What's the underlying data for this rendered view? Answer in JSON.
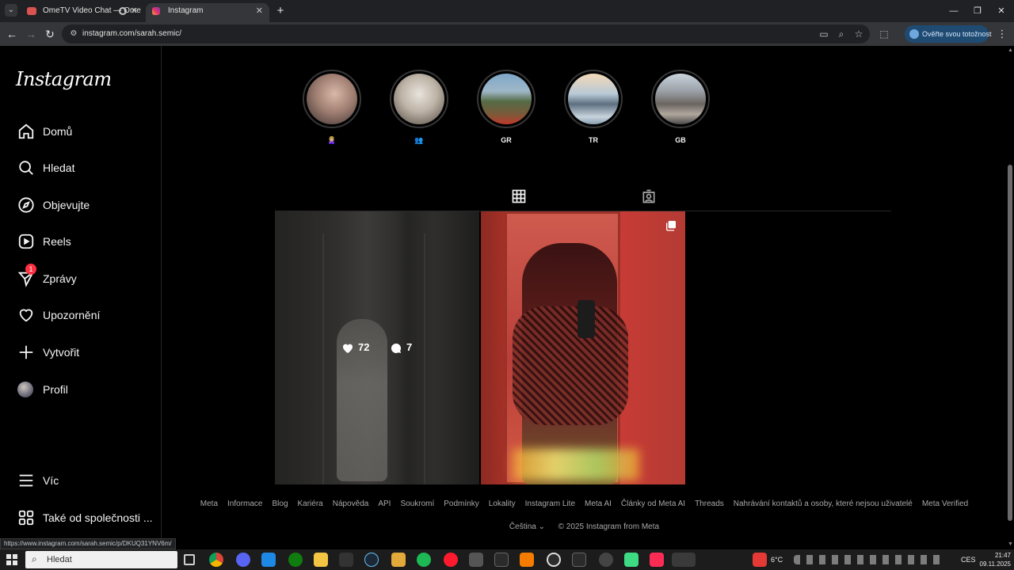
{
  "browser": {
    "tabs": [
      {
        "title": "OmeTV Video Chat — Ome",
        "active": false
      },
      {
        "title": "Instagram",
        "active": true
      }
    ],
    "url": "instagram.com/sarah.semic/",
    "verify_label": "Ověřte svou totožnost",
    "status_url": "https://www.instagram.com/sarah.semic/p/DKUQ31YNV6m/"
  },
  "instagram": {
    "logo": "Instagram",
    "nav": [
      {
        "label": "Domů",
        "icon": "home-icon"
      },
      {
        "label": "Hledat",
        "icon": "search-icon"
      },
      {
        "label": "Objevujte",
        "icon": "explore-compass-icon"
      },
      {
        "label": "Reels",
        "icon": "reels-icon"
      },
      {
        "label": "Zprávy",
        "icon": "messenger-icon",
        "badge": "1"
      },
      {
        "label": "Upozornění",
        "icon": "heart-icon"
      },
      {
        "label": "Vytvořit",
        "icon": "plus-icon"
      },
      {
        "label": "Profil",
        "icon": "avatar"
      },
      {
        "label": "Víc",
        "icon": "menu-icon"
      },
      {
        "label": "Také od společnosti ...",
        "icon": "meta-apps-icon"
      }
    ],
    "highlights": [
      {
        "label": "🙎🏼‍♀️"
      },
      {
        "label": "👥"
      },
      {
        "label": "GR"
      },
      {
        "label": "TR"
      },
      {
        "label": "GB"
      }
    ],
    "profile_tabs": [
      {
        "name": "posts-grid",
        "icon": "grid-icon",
        "active": true
      },
      {
        "name": "tagged",
        "icon": "tagged-icon",
        "active": false
      }
    ],
    "posts": [
      {
        "likes": "72",
        "comments": "7",
        "hovered": true
      },
      {
        "multi": true,
        "hovered": false
      }
    ],
    "footer_links": [
      "Meta",
      "Informace",
      "Blog",
      "Kariéra",
      "Nápověda",
      "API",
      "Soukromí",
      "Podmínky",
      "Lokality",
      "Instagram Lite",
      "Meta AI",
      "Články od Meta AI",
      "Threads",
      "Nahrávání kontaktů a osoby, které nejsou uživatelé",
      "Meta Verified"
    ],
    "language": "Čeština",
    "copyright": "© 2025 Instagram from Meta"
  },
  "taskbar": {
    "search_placeholder": "Hledat",
    "weather": "6°C",
    "language": "CES",
    "time": "21:47",
    "date": "09.11.2025"
  }
}
